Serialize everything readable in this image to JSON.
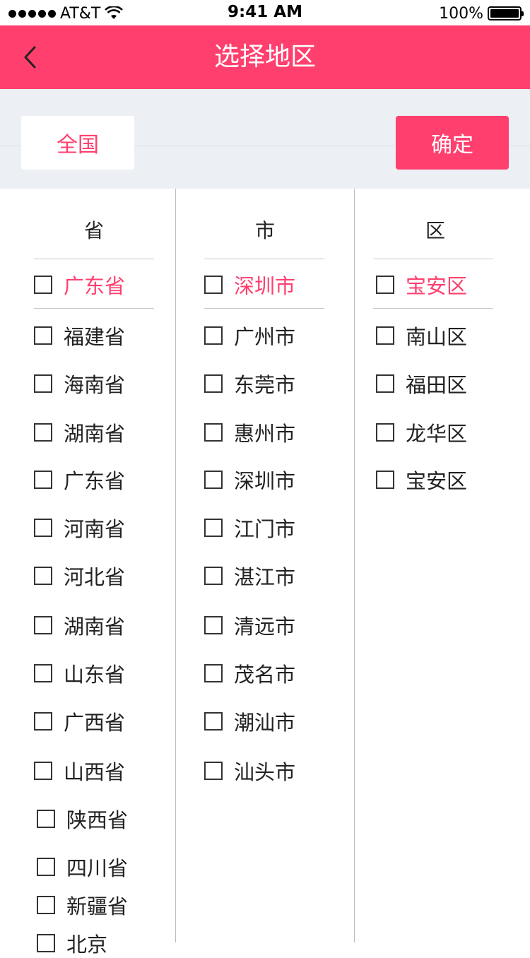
{
  "status_bar": {
    "carrier": "AT&T",
    "time": "9:41 AM",
    "battery": "100%"
  },
  "nav": {
    "title": "选择地区"
  },
  "filter": {
    "all_label": "全国",
    "confirm_label": "确定"
  },
  "columns": {
    "province": {
      "header": "省",
      "items": [
        "广东省",
        "福建省",
        "海南省",
        "湖南省",
        "广东省",
        "河南省",
        "河北省",
        "湖南省",
        "山东省",
        "广西省",
        "山西省",
        "陕西省",
        "四川省",
        "新疆省",
        "北京"
      ],
      "selected_index": 0
    },
    "city": {
      "header": "市",
      "items": [
        "深圳市",
        "广州市",
        "东莞市",
        "惠州市",
        "深圳市",
        "江门市",
        "湛江市",
        "清远市",
        "茂名市",
        "潮汕市",
        "汕头市"
      ],
      "selected_index": 0
    },
    "district": {
      "header": "区",
      "items": [
        "宝安区",
        "南山区",
        "福田区",
        "龙华区",
        "宝安区"
      ],
      "selected_index": 0
    }
  },
  "colors": {
    "accent": "#ff3f6e",
    "filter_bg": "#eceff4"
  }
}
